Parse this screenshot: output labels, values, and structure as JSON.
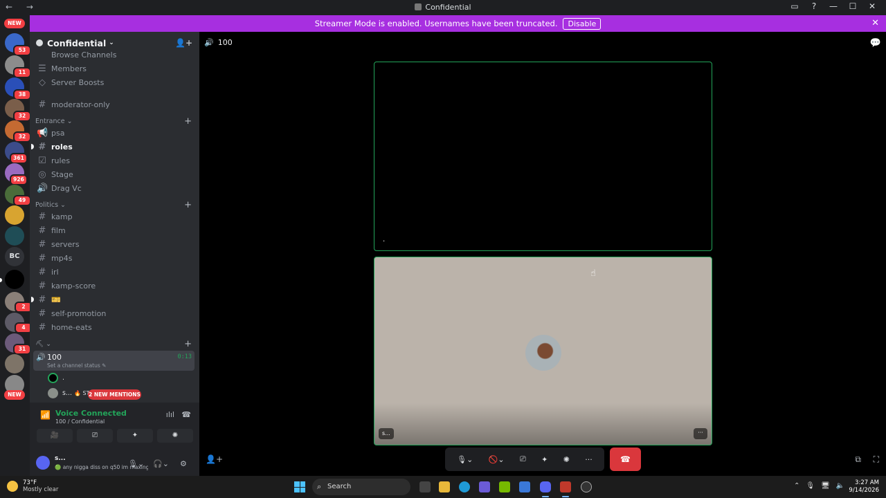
{
  "window": {
    "title": "Confidential",
    "nav": "← →",
    "controls": [
      "▭",
      "?",
      "—",
      "☐",
      "✕"
    ]
  },
  "banner": {
    "text": "Streamer Mode is enabled. Usernames have been truncated.",
    "button": "Disable",
    "close": "✕"
  },
  "rail": {
    "new_top": "NEW",
    "new_bottom": "NEW",
    "bc_label": "BC",
    "badges": [
      "53",
      "11",
      "38",
      "32",
      "32",
      "361",
      "926",
      "49",
      "2",
      "4",
      "31"
    ]
  },
  "server": {
    "name": "Confidential",
    "chevron": "⌄"
  },
  "channels": {
    "browse": "Browse Channels",
    "members": "Members",
    "boosts": "Server Boosts",
    "moderator_only": "moderator-only",
    "cat_entrance": "Entrance",
    "psa": "psa",
    "roles": "roles",
    "rules": "rules",
    "stage": "Stage",
    "drag_vc": "Drag Vc",
    "cat_politics": "Politics",
    "kamp": "kamp",
    "film": "film",
    "servers": "servers",
    "mp4s": "mp4s",
    "irl": "irl",
    "kamp_score": "kamp-score",
    "blank_emoji": "🎫",
    "self_promotion": "self-promotion",
    "home_eats": "home-eats",
    "cat_blank": "⌄",
    "plus": "+"
  },
  "voice_channel": {
    "name": "100",
    "status": "Set a channel status ✎",
    "timer": "0:13",
    "user1": ".",
    "user2": "s...",
    "user2_extra": "🔥 ST",
    "mentions": "2 NEW MENTIONS"
  },
  "voice_panel": {
    "connected": "Voice Connected",
    "sub": "100 / Confidential",
    "buttons": [
      "🎥",
      "⎚",
      "✦",
      "✺"
    ]
  },
  "user_panel": {
    "name": "s...",
    "status": "🟢 any nigga diss on q50 im maxing ..."
  },
  "stage": {
    "channel": "100",
    "tile1_name": ".",
    "tile2_name": "s...",
    "more": "···",
    "end_call": "☎"
  },
  "taskbar": {
    "temp": "73°F",
    "weather": "Mostly clear",
    "search": "Search",
    "time": "3:27 AM",
    "date": "9/14/2026"
  },
  "colors": {
    "banner": "#a72fe0",
    "voice_green": "#23a55a",
    "danger": "#da373c",
    "sidebar": "#2b2d31",
    "rail": "#1e1f22"
  }
}
